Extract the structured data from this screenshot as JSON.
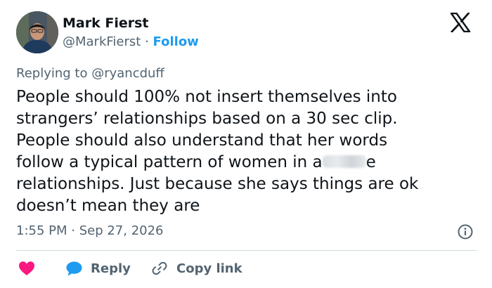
{
  "author": {
    "name": "Mark Fierst",
    "handle": "@MarkFierst",
    "separator": "·",
    "follow_label": "Follow"
  },
  "reply_context": "Replying to @ryancduff",
  "tweet": {
    "lines": [
      "People should 100% not insert themselves into",
      "strangers’ relationships based on a 30 sec clip.",
      "People should also understand that her words",
      "follow a typical pattern of women in a",
      "e",
      "relationships. Just because she says things are ok",
      "doesn’t mean they are"
    ]
  },
  "timestamp": "1:55 PM · Sep 27, 2026",
  "actions": {
    "reply_label": "Reply",
    "copy_link_label": "Copy link"
  },
  "colors": {
    "text": "#0f1419",
    "secondary": "#536471",
    "link": "#1d9bf0",
    "heart": "#f91880",
    "divider": "#cfd9de"
  },
  "icons": {
    "brand": "x-logo-icon",
    "info": "info-icon",
    "like": "heart-icon",
    "reply": "speech-bubble-icon",
    "copy": "link-icon"
  }
}
